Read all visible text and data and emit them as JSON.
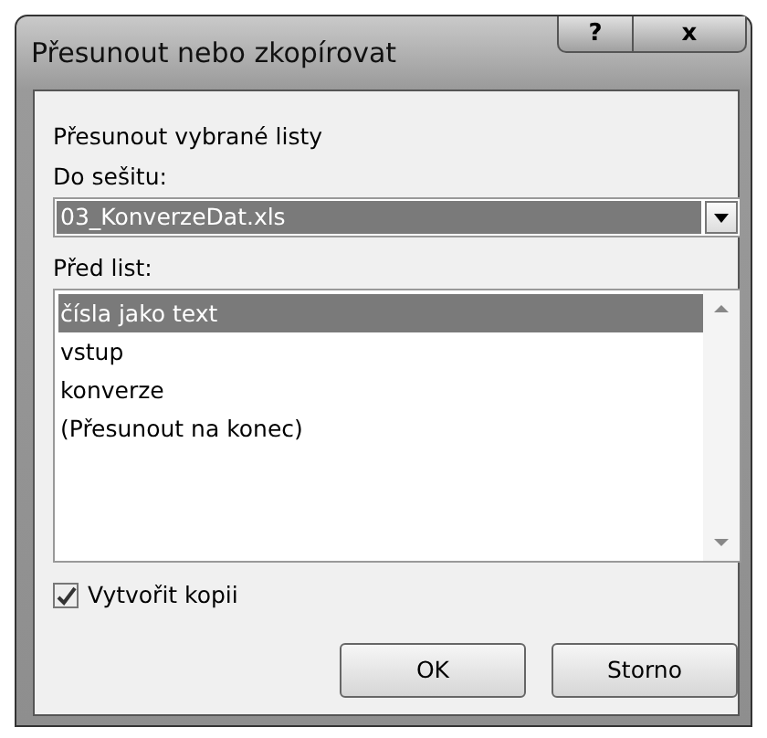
{
  "window": {
    "title": "Přesunout nebo zkopírovat",
    "buttons": [
      "?",
      "x"
    ]
  },
  "heading": "Přesunout vybrané listy",
  "workbook": {
    "label": "Do sešitu:",
    "value": "03_KonverzeDat.xls"
  },
  "sheets": {
    "label": "Před list:",
    "items": [
      {
        "text": "čísla jako text",
        "selected": true
      },
      {
        "text": "vstup",
        "selected": false
      },
      {
        "text": "konverze",
        "selected": false
      },
      {
        "text": "(Přesunout na konec)",
        "selected": false
      }
    ]
  },
  "copy": {
    "label": "Vytvořit kopii",
    "checked": true
  },
  "actions": [
    "OK",
    "Storno"
  ]
}
